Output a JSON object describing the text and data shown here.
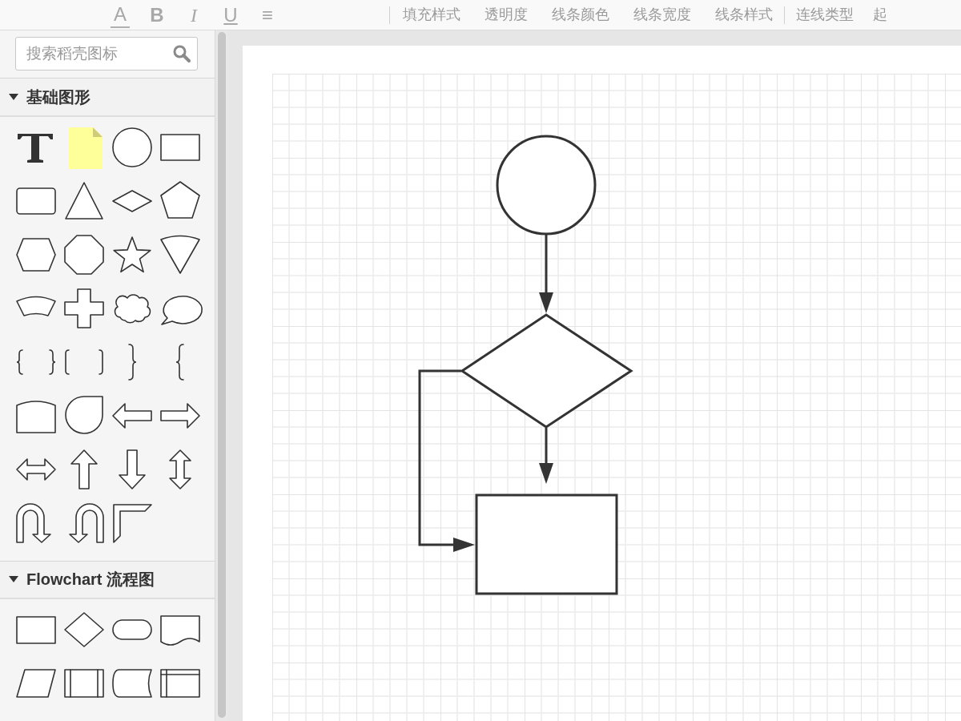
{
  "toolbar": {
    "format_buttons": [
      {
        "label": "A",
        "kind": "font-color"
      },
      {
        "label": "B",
        "kind": "bold"
      },
      {
        "label": "I",
        "kind": "italic"
      },
      {
        "label": "U",
        "kind": "underline"
      },
      {
        "label": "≡",
        "kind": "align"
      }
    ],
    "groups": [
      [
        "填充样式",
        "透明度",
        "线条颜色",
        "线条宽度",
        "线条样式"
      ],
      [
        "连线类型",
        "起"
      ]
    ]
  },
  "sidebar": {
    "search": {
      "placeholder": "搜索稻壳图标"
    },
    "sections": [
      {
        "title": "基础图形",
        "expanded": true
      },
      {
        "title": "Flowchart 流程图",
        "expanded": true
      }
    ]
  }
}
